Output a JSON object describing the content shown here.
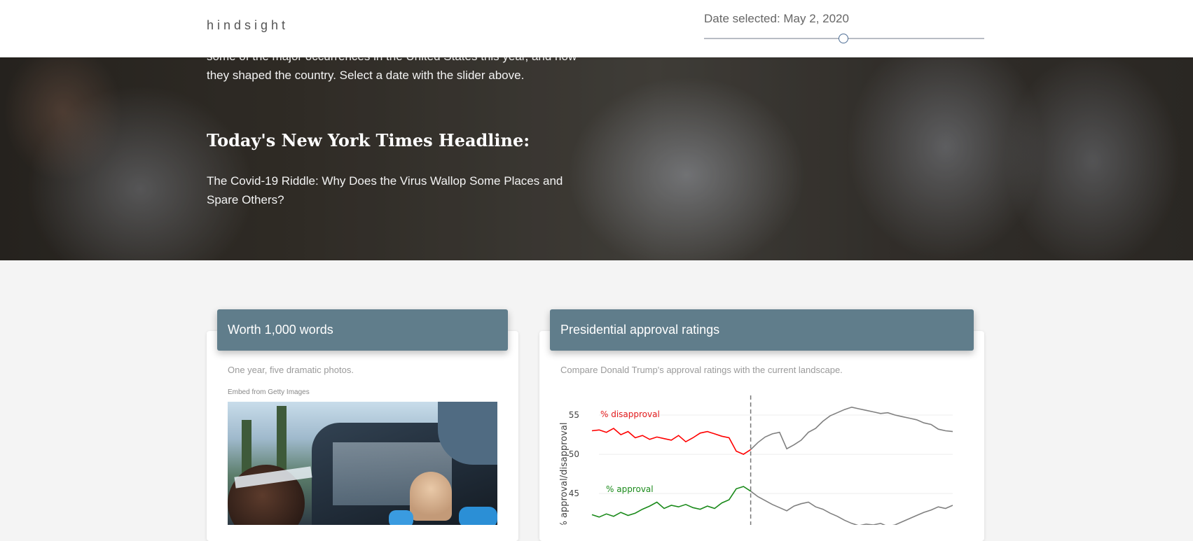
{
  "header": {
    "brand": "hindsight",
    "date_label": "Date selected: May 2, 2020",
    "slider": {
      "value": 0.497
    }
  },
  "hero": {
    "intro": "some of the major occurrences in the United States this year, and how they shaped the country. Select a date with the slider above.",
    "title": "Today's New York Times Headline:",
    "headline": "The Covid-19 Riddle: Why Does the Virus Wallop Some Places and Spare Others?"
  },
  "cards": {
    "photos": {
      "title": "Worth 1,000 words",
      "subtitle": "One year, five dramatic photos.",
      "embed_label": "Embed from Getty Images"
    },
    "approval": {
      "title": "Presidential approval ratings",
      "subtitle": "Compare Donald Trump's approval ratings with the current landscape."
    }
  },
  "chart_data": {
    "type": "line",
    "title": "",
    "ylabel": "% approval/disapproval",
    "ylim": [
      41,
      57.5
    ],
    "yticks": [
      45,
      50,
      55
    ],
    "selected_x": 0.44,
    "annotations": [
      {
        "text": "% disapproval",
        "color": "#e31a1c"
      },
      {
        "text": "% approval",
        "color": "#1a8a1a"
      }
    ],
    "series": [
      {
        "color_before": "#ff0000",
        "color_after": "#808080",
        "x": [
          0,
          0.02,
          0.04,
          0.06,
          0.08,
          0.1,
          0.12,
          0.14,
          0.16,
          0.18,
          0.2,
          0.22,
          0.24,
          0.26,
          0.28,
          0.3,
          0.32,
          0.34,
          0.36,
          0.38,
          0.4,
          0.42,
          0.44,
          0.46,
          0.48,
          0.5,
          0.52,
          0.54,
          0.56,
          0.58,
          0.6,
          0.62,
          0.64,
          0.66,
          0.68,
          0.7,
          0.72,
          0.74,
          0.76,
          0.78,
          0.8,
          0.82,
          0.84,
          0.86,
          0.88,
          0.9,
          0.92,
          0.94,
          0.96,
          0.98,
          1.0
        ],
        "values": [
          53.0,
          53.1,
          52.8,
          53.3,
          52.5,
          52.9,
          52.1,
          52.4,
          51.9,
          52.2,
          52.0,
          51.8,
          52.4,
          51.6,
          52.1,
          52.7,
          52.9,
          52.6,
          52.3,
          52.1,
          50.4,
          50.0,
          50.6,
          51.5,
          52.2,
          52.6,
          52.8,
          50.7,
          51.2,
          51.8,
          52.8,
          53.3,
          54.2,
          54.9,
          55.3,
          55.7,
          56.0,
          55.8,
          55.6,
          55.4,
          55.2,
          55.3,
          55.0,
          54.8,
          54.6,
          54.4,
          54.0,
          53.8,
          53.2,
          53.0,
          52.9
        ]
      },
      {
        "color_before": "#1a8a1a",
        "color_after": "#808080",
        "x": [
          0,
          0.02,
          0.04,
          0.06,
          0.08,
          0.1,
          0.12,
          0.14,
          0.16,
          0.18,
          0.2,
          0.22,
          0.24,
          0.26,
          0.28,
          0.3,
          0.32,
          0.34,
          0.36,
          0.38,
          0.4,
          0.42,
          0.44,
          0.46,
          0.48,
          0.5,
          0.52,
          0.54,
          0.56,
          0.58,
          0.6,
          0.62,
          0.64,
          0.66,
          0.68,
          0.7,
          0.72,
          0.74,
          0.76,
          0.78,
          0.8,
          0.82,
          0.84,
          0.86,
          0.88,
          0.9,
          0.92,
          0.94,
          0.96,
          0.98,
          1.0
        ],
        "values": [
          42.3,
          42.0,
          42.4,
          42.1,
          42.6,
          42.2,
          42.5,
          43.0,
          43.4,
          43.9,
          43.1,
          43.5,
          43.3,
          43.6,
          43.2,
          43.0,
          43.4,
          43.1,
          43.8,
          44.2,
          45.6,
          45.9,
          45.3,
          44.6,
          44.1,
          43.6,
          43.2,
          42.8,
          43.4,
          43.7,
          43.9,
          43.3,
          43.0,
          42.5,
          42.1,
          41.6,
          41.2,
          40.9,
          41.1,
          41.0,
          41.2,
          40.8,
          41.0,
          41.4,
          41.8,
          42.2,
          42.6,
          42.9,
          43.3,
          43.1,
          43.5
        ]
      }
    ]
  }
}
